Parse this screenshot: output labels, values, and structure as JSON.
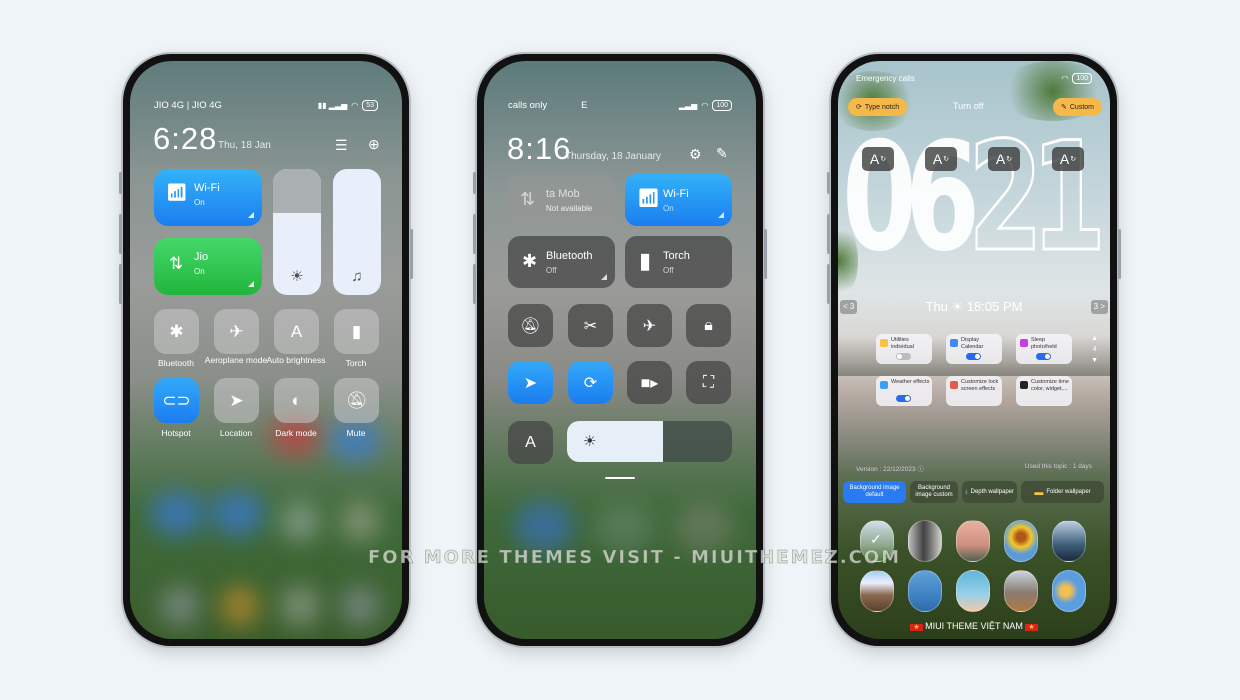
{
  "phone1": {
    "status": {
      "carrier": "JIO 4G | JIO 4G",
      "battery": "53"
    },
    "time": "6:28",
    "date": "Thu, 18 Jan",
    "tiles": [
      {
        "label": "Wi-Fi",
        "state": "On"
      },
      {
        "label": "Jio",
        "state": "On"
      }
    ],
    "sliders": {
      "brightness_level": 0.65,
      "volume_level": 1.0
    },
    "toggles": [
      {
        "label": "Bluetooth",
        "icon": "bluetooth-icon",
        "on": false
      },
      {
        "label": "Aeroplane mode",
        "icon": "airplane-icon",
        "on": false
      },
      {
        "label": "Auto brightness",
        "icon": "auto-brightness-icon",
        "on": false
      },
      {
        "label": "Torch",
        "icon": "torch-icon",
        "on": false
      },
      {
        "label": "Hotspot",
        "icon": "hotspot-icon",
        "on": true
      },
      {
        "label": "Location",
        "icon": "location-icon",
        "on": false
      },
      {
        "label": "Dark mode",
        "icon": "dark-mode-icon",
        "on": false
      },
      {
        "label": "Mute",
        "icon": "mute-icon",
        "on": false
      }
    ]
  },
  "phone2": {
    "status": {
      "carrier": "calls only",
      "network": "E",
      "battery": "100"
    },
    "time": "8:16",
    "date": "Thursday, 18 January",
    "tiles": [
      {
        "label": "ta      Mob",
        "state": "Not available"
      },
      {
        "label": "Wi-Fi",
        "state": "On"
      },
      {
        "label": "Bluetooth",
        "state": "Off"
      },
      {
        "label": "Torch",
        "state": "Off"
      }
    ],
    "toggles": [
      {
        "icon": "mute-icon",
        "on": false
      },
      {
        "icon": "screenshot-icon",
        "on": false
      },
      {
        "icon": "airplane-icon",
        "on": false
      },
      {
        "icon": "lock-icon",
        "on": false
      },
      {
        "icon": "location-icon",
        "on": true
      },
      {
        "icon": "rotation-lock-icon",
        "on": true
      },
      {
        "icon": "video-camera-icon",
        "on": false
      },
      {
        "icon": "scan-icon",
        "on": false
      }
    ],
    "auto_brightness_label": "A",
    "brightness_level": 0.58
  },
  "phone3": {
    "status": {
      "left": "Emergency calls",
      "battery": "100"
    },
    "type_notch_label": "Type notch",
    "turn_off_label": "Turn off",
    "custom_label": "Custom",
    "clock_digits": [
      "0",
      "6",
      "2",
      "1"
    ],
    "font_button_label": "A",
    "nav_prev": "< 3",
    "nav_next": "3 >",
    "date_line": "Thu",
    "time_line": "18:05 PM",
    "widgets": [
      {
        "label": "Utilities individual",
        "toggle": "off",
        "color": "#f5c542"
      },
      {
        "label": "Display Calendar",
        "toggle": "on",
        "color": "#3d8af7"
      },
      {
        "label": "Sleep photo/held",
        "toggle": "on",
        "color": "#c83ce6"
      },
      {
        "label": "Weather effects",
        "toggle": "on",
        "color": "#3aa0f5"
      },
      {
        "label": "Customize lock screen effects",
        "toggle": null,
        "color": "#e35a4f"
      },
      {
        "label": "Customize time color, widget,...",
        "toggle": null,
        "color": "#222222"
      }
    ],
    "version": "Version : 22/12/2023",
    "used": "Used this topic : 1 days",
    "options": [
      {
        "label": "Background image default",
        "selected": true
      },
      {
        "label": "Background image custom",
        "selected": false
      },
      {
        "label": "Depth wallpaper",
        "selected": false
      },
      {
        "label": "Folder wallpaper",
        "selected": false
      }
    ],
    "thumbnails": [
      {
        "name": "mountain-lake",
        "selected": true
      },
      {
        "name": "skyscraper"
      },
      {
        "name": "bare-tree-sunset"
      },
      {
        "name": "sunflower"
      },
      {
        "name": "lighthouse"
      },
      {
        "name": "plane-tower"
      },
      {
        "name": "bird-sky"
      },
      {
        "name": "plane-clouds"
      },
      {
        "name": "city-hill"
      },
      {
        "name": "yellow-flowers"
      }
    ],
    "footer": "MIUI THEME VIỆT NAM"
  },
  "watermark": "FOR MORE THEMES VISIT - MIUITHEMEZ.COM"
}
